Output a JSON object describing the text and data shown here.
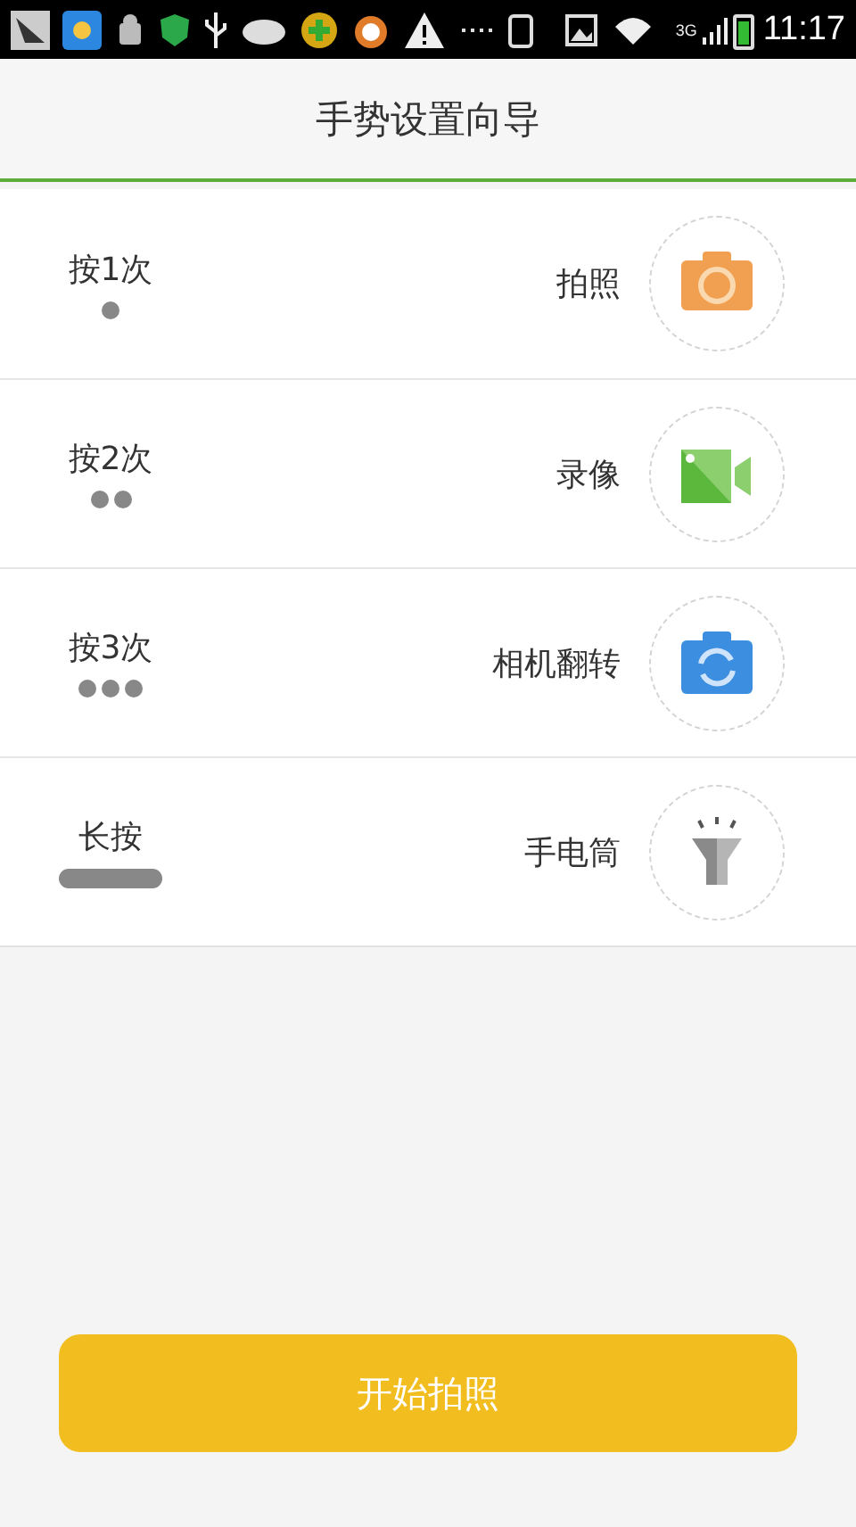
{
  "status_bar": {
    "network": "3G",
    "time": "11:17"
  },
  "header": {
    "title": "手势设置向导"
  },
  "gestures": [
    {
      "press": {
        "label": "按1次",
        "kind": "single"
      },
      "action": {
        "label": "拍照",
        "kind": "camera"
      }
    },
    {
      "press": {
        "label": "按2次",
        "kind": "double"
      },
      "action": {
        "label": "录像",
        "kind": "video"
      }
    },
    {
      "press": {
        "label": "按3次",
        "kind": "triple"
      },
      "action": {
        "label": "相机翻转",
        "kind": "switch-camera"
      }
    },
    {
      "press": {
        "label": "长按",
        "kind": "long"
      },
      "action": {
        "label": "手电筒",
        "kind": "flashlight"
      }
    }
  ],
  "start_button": {
    "label": "开始拍照"
  }
}
